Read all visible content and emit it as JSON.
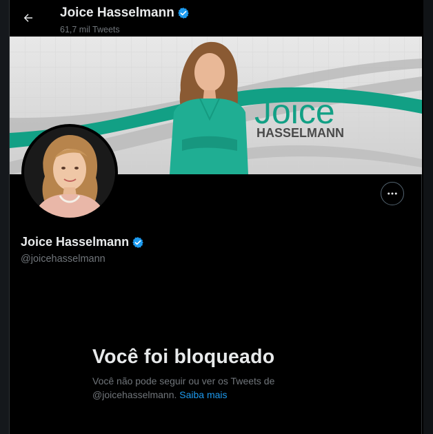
{
  "header": {
    "title": "Joice Hasselmann",
    "tweet_count": "61,7 mil Tweets"
  },
  "banner": {
    "brand_first": "Joice",
    "brand_last": "HASSELMANN"
  },
  "profile": {
    "name": "Joice Hasselmann",
    "handle": "@joicehasselmann",
    "verified": true
  },
  "blocked": {
    "title": "Você foi bloqueado",
    "message_line1": "Você não pode seguir ou ver os Tweets de",
    "message_line2": "@joicehasselmann.",
    "link": "Saiba mais"
  },
  "colors": {
    "accent": "#1d9bf0",
    "banner_teal": "#12a085",
    "background": "#000000"
  },
  "icons": {
    "back": "arrow-left-icon",
    "verified": "verified-badge-icon",
    "more": "more-horizontal-icon"
  }
}
